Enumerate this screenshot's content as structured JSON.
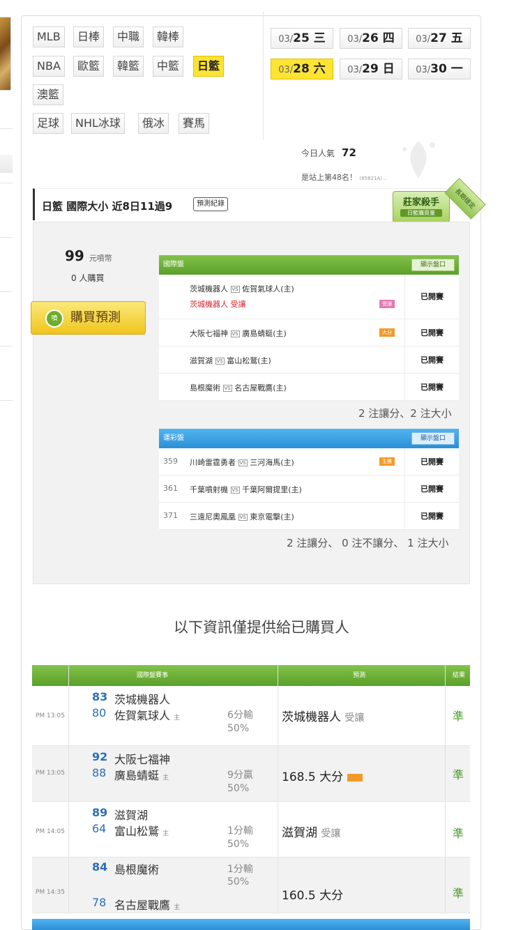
{
  "leagues": {
    "row1": [
      "MLB",
      "日棒",
      "中職",
      "韓棒"
    ],
    "row2": [
      "NBA",
      "歐籃",
      "韓籃",
      "中籃",
      "日籃"
    ],
    "row3": [
      "澳籃"
    ],
    "row4": [
      "足球",
      "NHL冰球",
      "俄冰",
      "賽馬"
    ]
  },
  "dates": [
    {
      "md": "03/",
      "d": "25 三"
    },
    {
      "md": "03/",
      "d": "26 四"
    },
    {
      "md": "03/",
      "d": "27 五"
    },
    {
      "md": "03/",
      "d": "28 六"
    },
    {
      "md": "03/",
      "d": "29 日"
    },
    {
      "md": "03/",
      "d": "30 一"
    }
  ],
  "popularity": {
    "label": "今日人氣",
    "value": "72",
    "rank_text": "是站上第48名！",
    "rank_note": "(85821A)..."
  },
  "header": {
    "title": "日籃 國際大小 近8日11過9",
    "record_btn": "預測紀錄",
    "badge_title": "莊家殺手",
    "badge_sub": "日籃購買量",
    "ribbon": "長期穩定"
  },
  "purchase": {
    "price": "99",
    "currency": "元噴幣",
    "buyers": "0 人購買",
    "button": "購買預測",
    "coin_label": "噴"
  },
  "intl_table": {
    "title": "國際盤",
    "show_btn": "顯示盤口",
    "rows": [
      {
        "home": "茨城機器人",
        "away": "佐賀氣球人(主)",
        "pick": "茨城機器人 受讓",
        "tag": "受讓",
        "status": "已開賽"
      },
      {
        "home": "大阪七福神",
        "away": "廣島蜻蜓(主)",
        "tag": "大分",
        "status": "已開賽"
      },
      {
        "home": "滋賀湖",
        "away": "富山松鷲(主)",
        "status": "已開賽"
      },
      {
        "home": "島根魔術",
        "away": "名古屋戰鷹(主)",
        "status": "已開賽"
      }
    ],
    "summary": "2 注讓分、2 注大小"
  },
  "sport_table": {
    "title": "運彩盤",
    "show_btn": "顯示盤口",
    "rows": [
      {
        "num": "359",
        "home": "川崎雷霆勇者",
        "away": "三河海馬(主)",
        "tag": "主勝",
        "status": "已開賽"
      },
      {
        "num": "361",
        "home": "千葉噴射機",
        "away": "千葉阿爾提里(主)",
        "status": "已開賽"
      },
      {
        "num": "371",
        "home": "三遠尼奧鳳凰",
        "away": "東京電擊(主)",
        "status": "已開賽"
      }
    ],
    "summary": "2 注讓分、 0 注不讓分、 1 注大小"
  },
  "vs": "VS",
  "notice": "以下資訊僅提供給已購買人",
  "bought_table": {
    "headers": {
      "event": "國際盤賽事",
      "prediction": "預測",
      "result": "結果"
    },
    "home_mark": "主",
    "rows": [
      {
        "time": "PM 13:05",
        "score1": "83",
        "team1": "茨城機器人",
        "score2": "80",
        "team2": "佐賀氣球人",
        "odds": "6分輸",
        "pct": "50%",
        "pred": "茨城機器人",
        "pred_note": "受讓",
        "result": "準"
      },
      {
        "time": "PM 13:05",
        "score1": "92",
        "team1": "大阪七福神",
        "score2": "88",
        "team2": "廣島蜻蜓",
        "odds": "9分贏",
        "pct": "50%",
        "pred": "168.5 大分",
        "pred_note": "",
        "result": "準"
      },
      {
        "time": "PM 14:05",
        "score1": "89",
        "team1": "滋賀湖",
        "score2": "64",
        "team2": "富山松鷲",
        "odds": "1分輸",
        "pct": "50%",
        "pred": "滋賀湖",
        "pred_note": "受讓",
        "result": "準"
      },
      {
        "time": "PM 14:35",
        "score1": "84",
        "team1": "島根魔術",
        "score2": "78",
        "team2": "名古屋戰鷹",
        "odds": "1分輸",
        "pct": "50%",
        "pred": "160.5 大分",
        "pred_note": "",
        "result": "準"
      }
    ]
  }
}
